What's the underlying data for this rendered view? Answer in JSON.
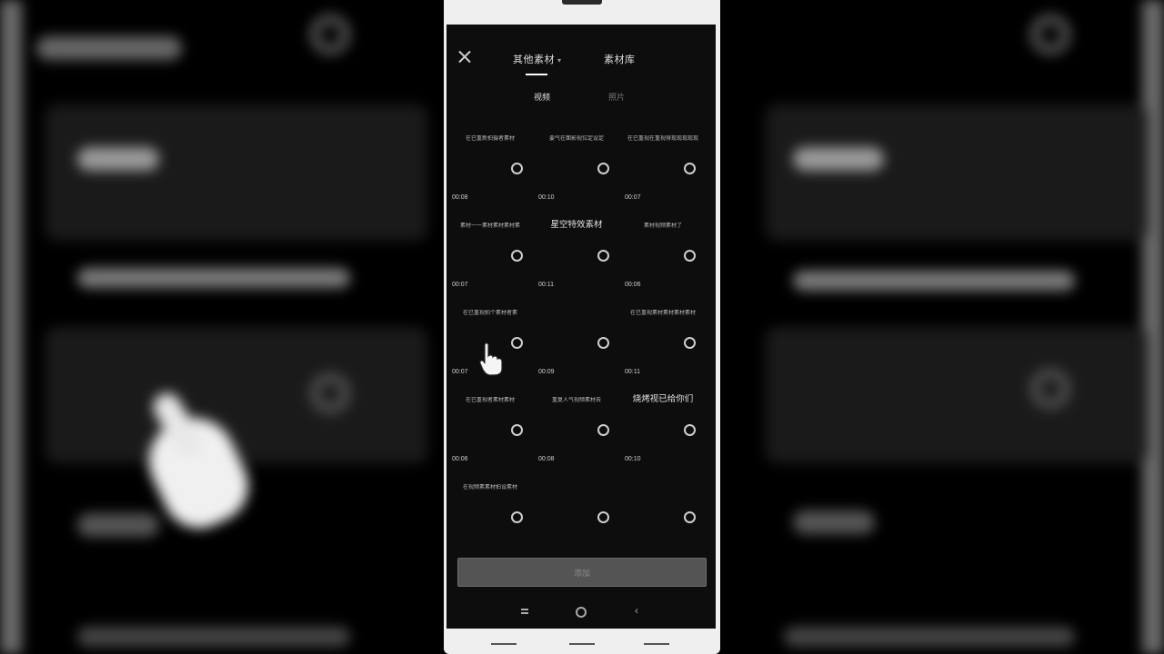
{
  "header": {
    "tabs": [
      {
        "label": "其他素材",
        "caret": "▾"
      },
      {
        "label": "素材库"
      }
    ],
    "subtabs": [
      "视频",
      "照片"
    ]
  },
  "items": [
    {
      "title": "在已重新拍摄者素材",
      "duration": "00:08",
      "big": false
    },
    {
      "title": "要气在面影视位定设定",
      "duration": "00:10",
      "big": false
    },
    {
      "title": "在已重视在重视得现现现现现",
      "duration": "00:07",
      "big": false
    },
    {
      "title": "素材一一素材素材素材素",
      "duration": "00:07",
      "big": false
    },
    {
      "title": "星空特效素材",
      "duration": "00:11",
      "big": true
    },
    {
      "title": "素材视频素材了",
      "duration": "00:06",
      "big": false
    },
    {
      "title": "在已重视拍个素材者素",
      "duration": "00:07",
      "big": false
    },
    {
      "title": "",
      "duration": "00:09",
      "big": false
    },
    {
      "title": "在已重视素材素材素材素材",
      "duration": "00:11",
      "big": false
    },
    {
      "title": "在已重视者素材素材",
      "duration": "00:06",
      "big": false
    },
    {
      "title": "重复人气视频素材去",
      "duration": "00:08",
      "big": false
    },
    {
      "title": "烧烤视已给你们",
      "duration": "00:10",
      "big": true
    },
    {
      "title": "在视频素素材拍设素材",
      "duration": "",
      "big": false
    },
    {
      "title": "",
      "duration": "",
      "big": false
    },
    {
      "title": "",
      "duration": "",
      "big": false
    }
  ],
  "footer": {
    "button_label": "添加"
  },
  "colors": {
    "screen_bg": "#0d0d0d",
    "phone_frame": "#efefef",
    "button_bg": "#545454"
  },
  "icons": {
    "close": "close-icon",
    "nav": [
      "menu-icon",
      "home-icon",
      "back-icon"
    ]
  }
}
